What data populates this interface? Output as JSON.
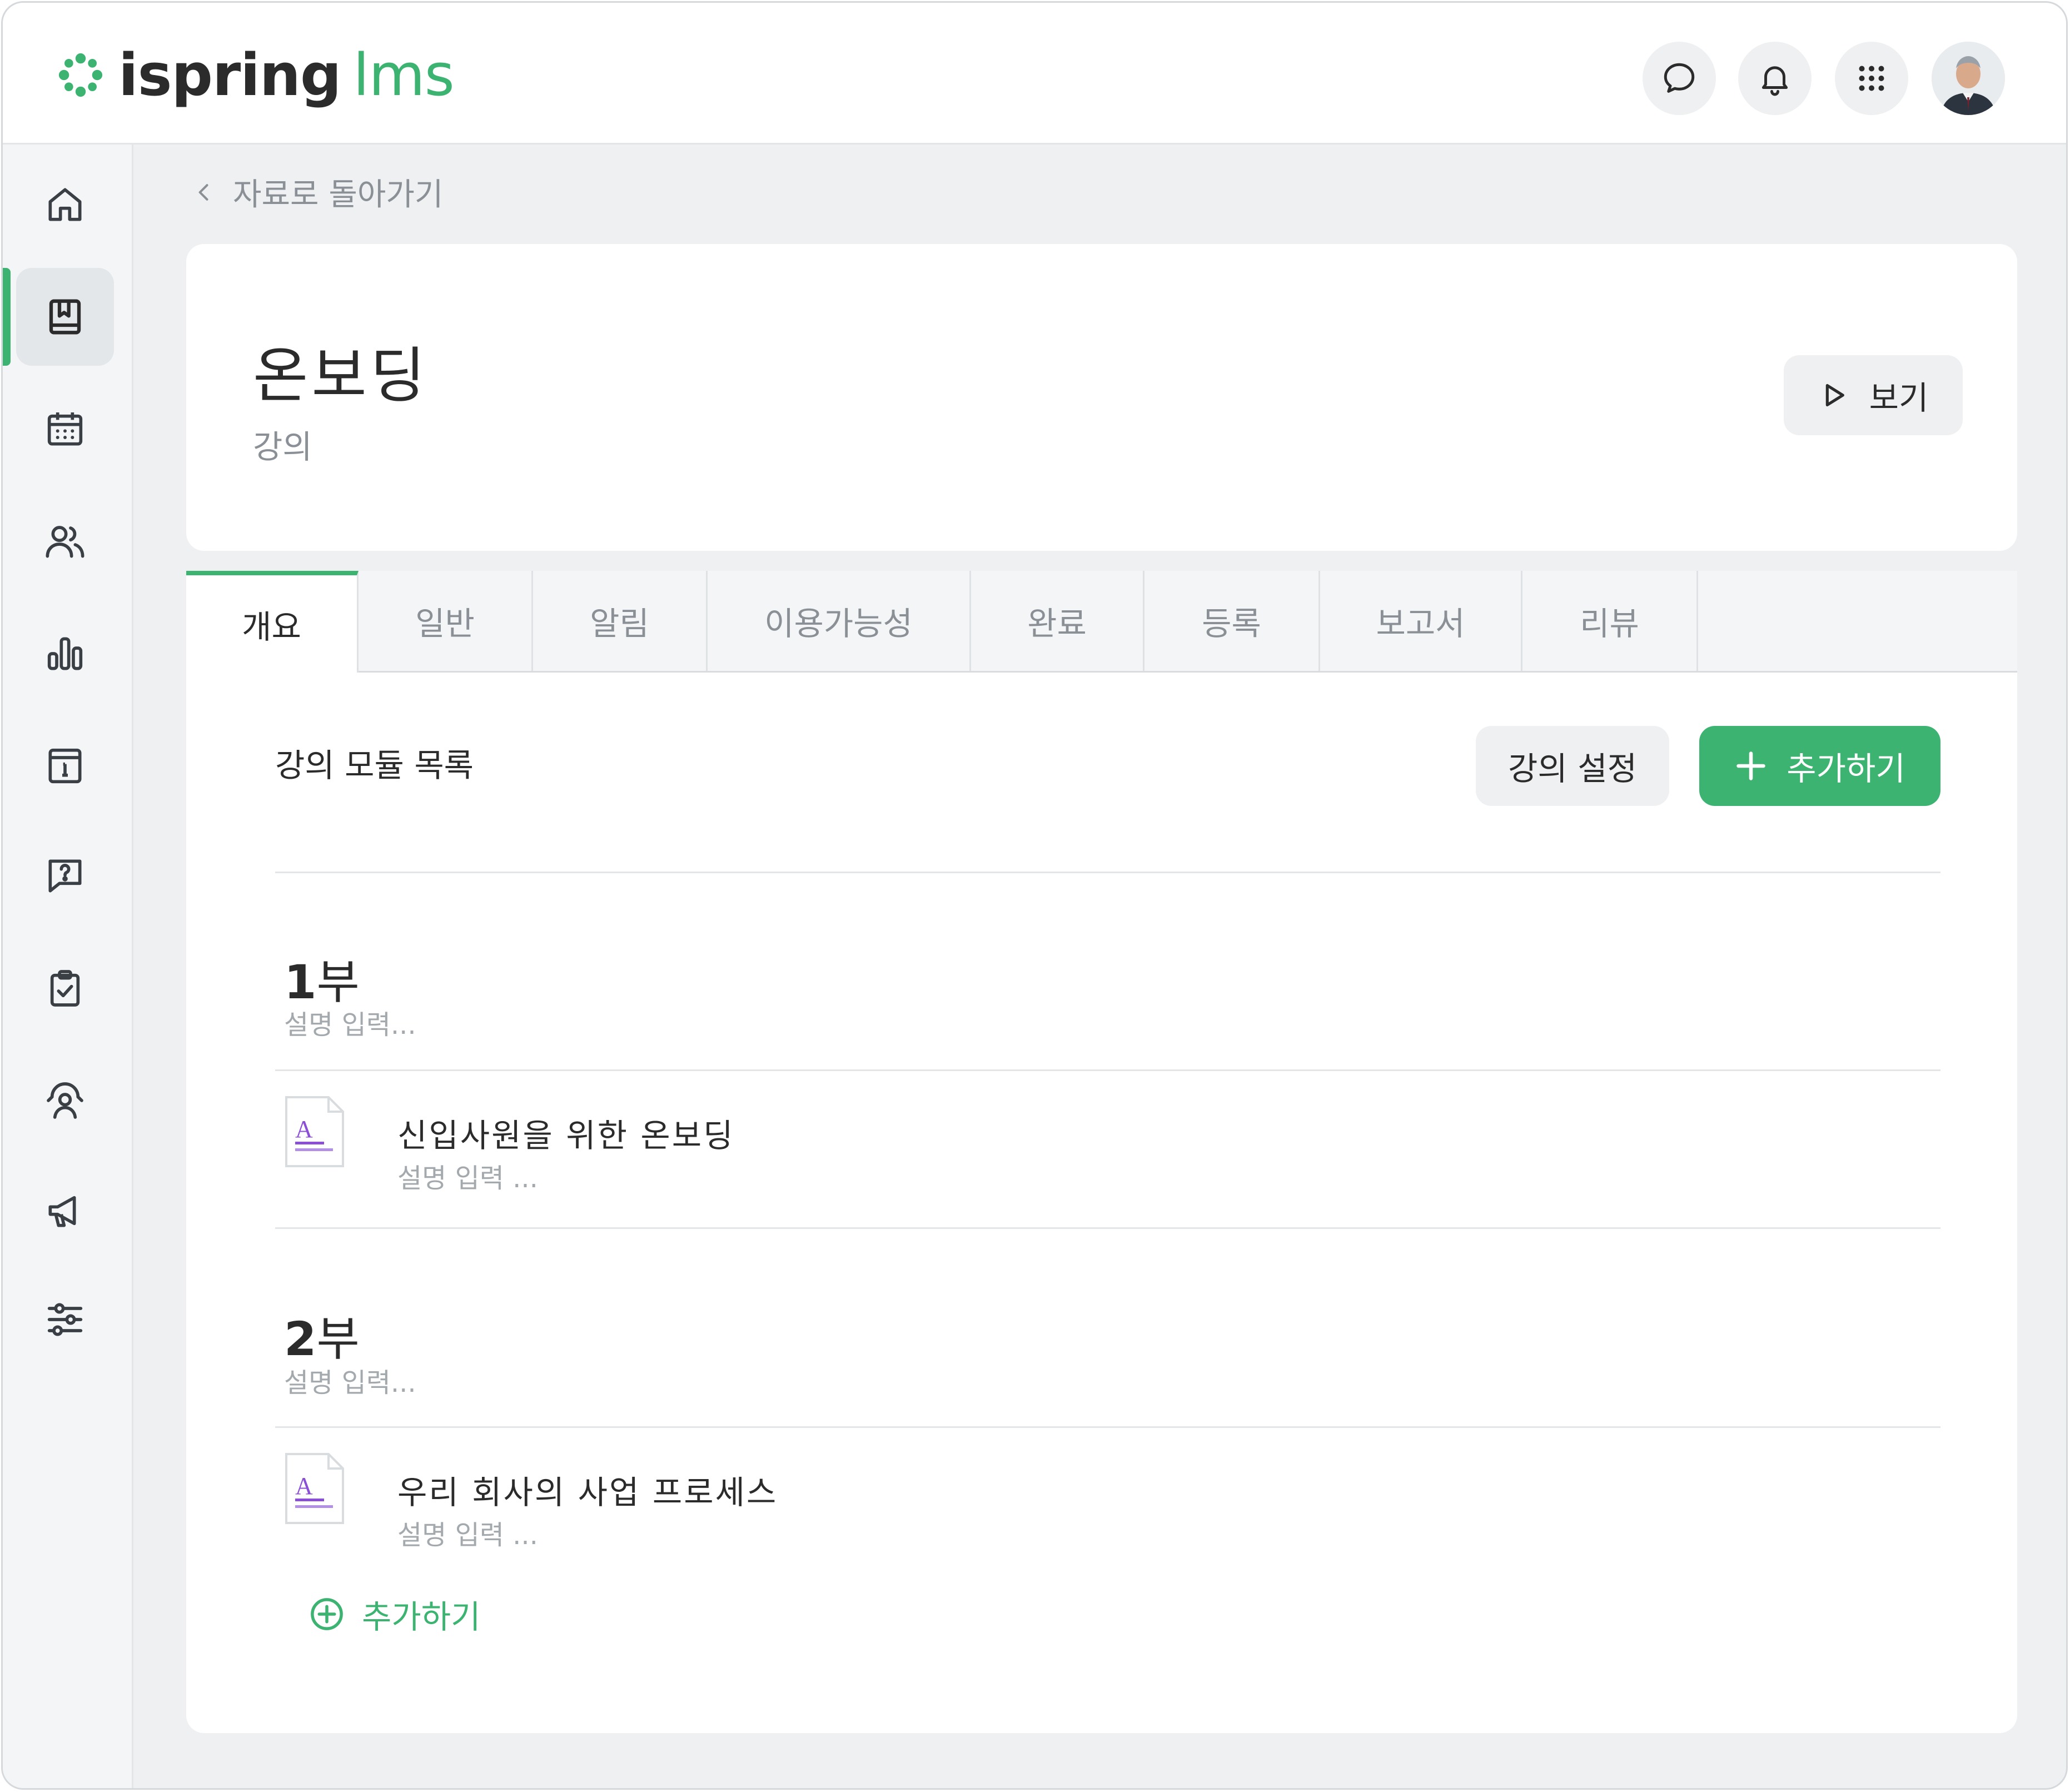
{
  "app": {
    "brand": "ispring",
    "product": "lms"
  },
  "topbar": {
    "icons": [
      "chat-icon",
      "bell-icon",
      "apps-grid-icon"
    ],
    "avatar": "user-avatar"
  },
  "sidebar": {
    "items": [
      {
        "icon": "home-icon",
        "active": false
      },
      {
        "icon": "content-icon",
        "active": true
      },
      {
        "icon": "calendar-icon",
        "active": false
      },
      {
        "icon": "users-icon",
        "active": false
      },
      {
        "icon": "reports-icon",
        "active": false
      },
      {
        "icon": "info-icon",
        "active": false
      },
      {
        "icon": "question-icon",
        "active": false
      },
      {
        "icon": "assignment-icon",
        "active": false
      },
      {
        "icon": "meeting-icon",
        "active": false
      },
      {
        "icon": "megaphone-icon",
        "active": false
      },
      {
        "icon": "settings-sliders-icon",
        "active": false
      }
    ]
  },
  "back": {
    "label": "자료로 돌아가기"
  },
  "header": {
    "title": "온보딩",
    "subtitle": "강의",
    "view_label": "보기"
  },
  "tabs": [
    {
      "label": "개요",
      "active": true
    },
    {
      "label": "일반",
      "active": false
    },
    {
      "label": "알림",
      "active": false
    },
    {
      "label": "이용가능성",
      "active": false
    },
    {
      "label": "완료",
      "active": false
    },
    {
      "label": "등록",
      "active": false
    },
    {
      "label": "보고서",
      "active": false
    },
    {
      "label": "리뷰",
      "active": false
    }
  ],
  "content": {
    "heading": "강의 모듈 목록",
    "settings_label": "강의 설정",
    "add_label": "추가하기",
    "parts": [
      {
        "number": "1",
        "suffix": "부",
        "desc": "설명 입력...",
        "module": {
          "title": "신입사원을 위한 온보딩",
          "desc": "설명 입력 ..."
        }
      },
      {
        "number": "2",
        "suffix": "부",
        "desc": "설명 입력...",
        "module": {
          "title": "우리 회사의 사업 프로세스",
          "desc": "설명 입력 ..."
        }
      }
    ],
    "add_link_label": "추가하기"
  },
  "colors": {
    "accent": "#3cb371",
    "text": "#2b2b2b",
    "muted": "#8a9096",
    "background": "#eef0f2"
  }
}
